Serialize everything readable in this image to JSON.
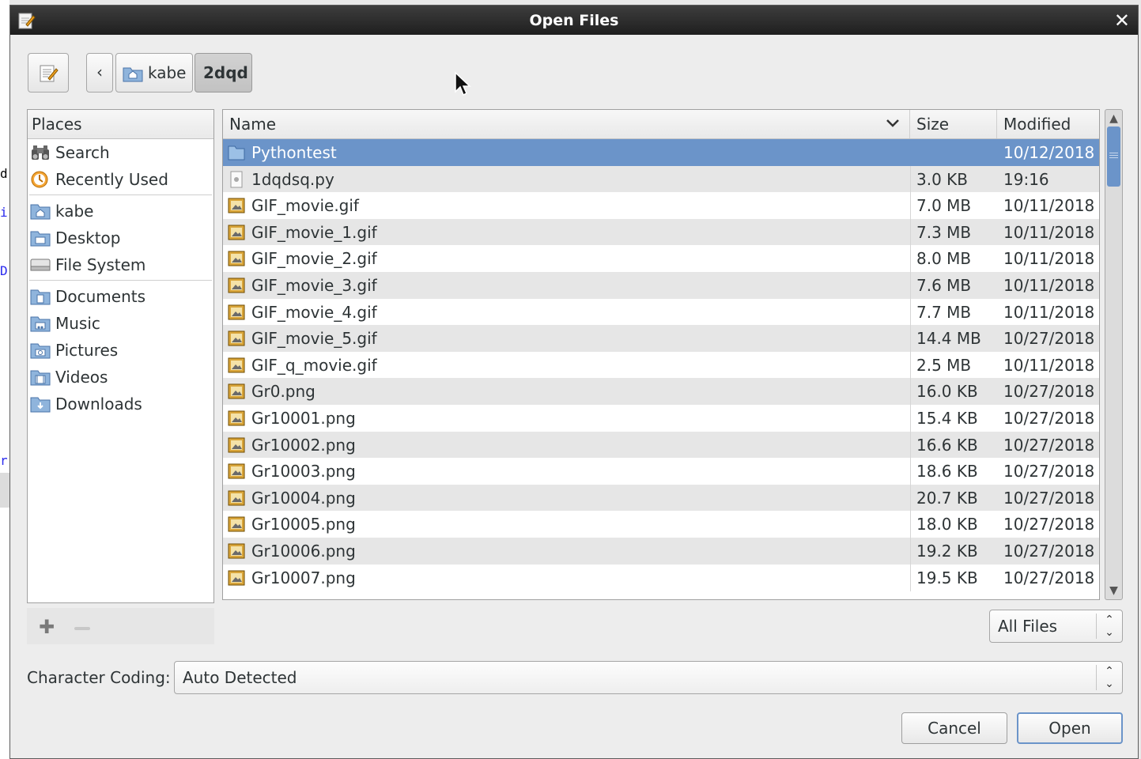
{
  "window": {
    "title": "Open Files"
  },
  "background_text": [
    "d",
    "i",
    "D",
    "r"
  ],
  "pathbar": {
    "crumbs": [
      "kabe",
      "2dqd"
    ],
    "back_label": "‹"
  },
  "places": {
    "header": "Places",
    "items": [
      {
        "label": "Search",
        "icon": "binoculars-icon"
      },
      {
        "label": "Recently Used",
        "icon": "clock-icon"
      },
      {
        "label": "kabe",
        "icon": "home-folder-icon"
      },
      {
        "label": "Desktop",
        "icon": "desktop-folder-icon"
      },
      {
        "label": "File System",
        "icon": "drive-icon"
      },
      {
        "label": "Documents",
        "icon": "documents-folder-icon"
      },
      {
        "label": "Music",
        "icon": "music-folder-icon"
      },
      {
        "label": "Pictures",
        "icon": "pictures-folder-icon"
      },
      {
        "label": "Videos",
        "icon": "videos-folder-icon"
      },
      {
        "label": "Downloads",
        "icon": "downloads-folder-icon"
      }
    ]
  },
  "files": {
    "columns": {
      "name": "Name",
      "size": "Size",
      "modified": "Modified"
    },
    "rows": [
      {
        "name": "Pythontest",
        "size": "",
        "modified": "10/12/2018",
        "type": "folder",
        "selected": true
      },
      {
        "name": "1dqdsq.py",
        "size": "3.0 KB",
        "modified": "19:16",
        "type": "script"
      },
      {
        "name": "GIF_movie.gif",
        "size": "7.0 MB",
        "modified": "10/11/2018",
        "type": "image"
      },
      {
        "name": "GIF_movie_1.gif",
        "size": "7.3 MB",
        "modified": "10/11/2018",
        "type": "image"
      },
      {
        "name": "GIF_movie_2.gif",
        "size": "8.0 MB",
        "modified": "10/11/2018",
        "type": "image"
      },
      {
        "name": "GIF_movie_3.gif",
        "size": "7.6 MB",
        "modified": "10/11/2018",
        "type": "image"
      },
      {
        "name": "GIF_movie_4.gif",
        "size": "7.7 MB",
        "modified": "10/11/2018",
        "type": "image"
      },
      {
        "name": "GIF_movie_5.gif",
        "size": "14.4 MB",
        "modified": "10/27/2018",
        "type": "image"
      },
      {
        "name": "GIF_q_movie.gif",
        "size": "2.5 MB",
        "modified": "10/11/2018",
        "type": "image"
      },
      {
        "name": "Gr0.png",
        "size": "16.0 KB",
        "modified": "10/27/2018",
        "type": "image"
      },
      {
        "name": "Gr10001.png",
        "size": "15.4 KB",
        "modified": "10/27/2018",
        "type": "image"
      },
      {
        "name": "Gr10002.png",
        "size": "16.6 KB",
        "modified": "10/27/2018",
        "type": "image"
      },
      {
        "name": "Gr10003.png",
        "size": "18.6 KB",
        "modified": "10/27/2018",
        "type": "image"
      },
      {
        "name": "Gr10004.png",
        "size": "20.7 KB",
        "modified": "10/27/2018",
        "type": "image"
      },
      {
        "name": "Gr10005.png",
        "size": "18.0 KB",
        "modified": "10/27/2018",
        "type": "image"
      },
      {
        "name": "Gr10006.png",
        "size": "19.2 KB",
        "modified": "10/27/2018",
        "type": "image"
      },
      {
        "name": "Gr10007.png",
        "size": "19.5 KB",
        "modified": "10/27/2018",
        "type": "image"
      }
    ]
  },
  "filter": {
    "value": "All Files"
  },
  "character_coding": {
    "label": "Character Coding:",
    "value": "Auto Detected"
  },
  "buttons": {
    "cancel": "Cancel",
    "open": "Open"
  },
  "colors": {
    "selection": "#6b94c9",
    "titlebar": "#2b2b2b",
    "row_alt": "#e6e6e6"
  }
}
